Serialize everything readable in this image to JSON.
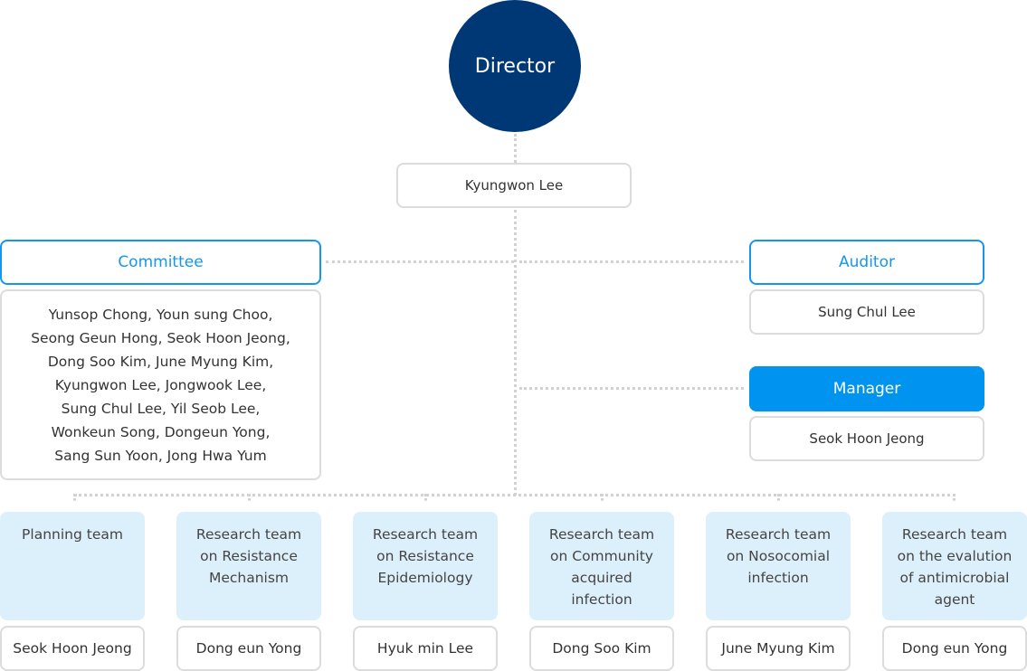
{
  "director": {
    "label": "Director",
    "name": "Kyungwon Lee"
  },
  "committee": {
    "label": "Committee",
    "members_lines": [
      "Yunsop Chong, Youn sung Choo,",
      "Seong Geun Hong, Seok Hoon Jeong,",
      "Dong Soo Kim, June Myung Kim,",
      "Kyungwon Lee, Jongwook Lee,",
      "Sung Chul Lee, Yil Seob Lee,",
      "Wonkeun Song, Dongeun Yong,",
      "Sang Sun Yoon, Jong Hwa Yum"
    ]
  },
  "auditor": {
    "label": "Auditor",
    "name": "Sung Chul Lee"
  },
  "manager": {
    "label": "Manager",
    "name": "Seok Hoon Jeong"
  },
  "teams": [
    {
      "lines": [
        "Planning team"
      ],
      "lead": "Seok Hoon Jeong"
    },
    {
      "lines": [
        "Research team",
        "on Resistance",
        "Mechanism"
      ],
      "lead": "Dong eun Yong"
    },
    {
      "lines": [
        "Research team",
        "on Resistance",
        "Epidemiology"
      ],
      "lead": "Hyuk min Lee"
    },
    {
      "lines": [
        "Research team",
        "on Community",
        "acquired",
        "infection"
      ],
      "lead": "Dong Soo Kim"
    },
    {
      "lines": [
        "Research team",
        "on Nosocomial",
        "infection"
      ],
      "lead": "June Myung Kim"
    },
    {
      "lines": [
        "Research team",
        "on the evalution",
        "of antimicrobial",
        "agent"
      ],
      "lead": "Dong eun Yong"
    }
  ],
  "colors": {
    "director": "#003876",
    "accent": "#1596ee",
    "manager": "#0094f0",
    "team_bg": "#dcf0fc",
    "border": "#dcdcdc"
  }
}
